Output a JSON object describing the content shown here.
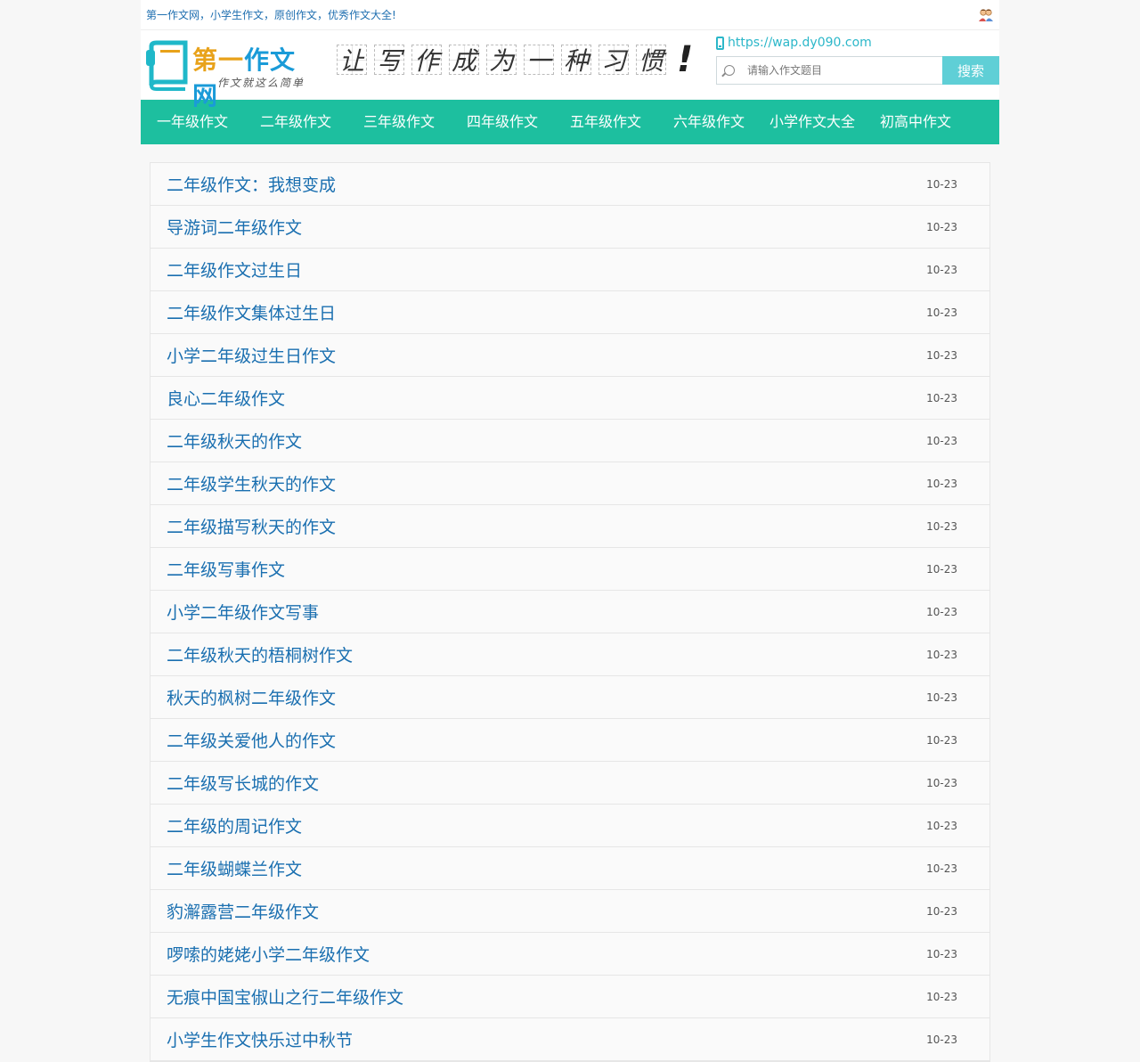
{
  "topbar": {
    "slogan": "第一作文网，小学生作文，原创作文，优秀作文大全!"
  },
  "header": {
    "logo_main": "第一作文网",
    "logo_first": "第一",
    "logo_rest": "作文网",
    "logo_tagline": "作文就这么简单",
    "motto_chars": [
      "让",
      "写",
      "作",
      "成",
      "为",
      "一",
      "种",
      "习",
      "惯"
    ],
    "motto_end": "!",
    "mobile_url": "https://wap.dy090.com",
    "search": {
      "placeholder": "请输入作文题目",
      "button": "搜索"
    }
  },
  "nav": {
    "items": [
      "一年级作文",
      "二年级作文",
      "三年级作文",
      "四年级作文",
      "五年级作文",
      "六年级作文",
      "小学作文大全",
      "初高中作文"
    ]
  },
  "articles": [
    {
      "title": "二年级作文：我想变成",
      "date": "10-23"
    },
    {
      "title": "导游词二年级作文",
      "date": "10-23"
    },
    {
      "title": "二年级作文过生日",
      "date": "10-23"
    },
    {
      "title": "二年级作文集体过生日",
      "date": "10-23"
    },
    {
      "title": "小学二年级过生日作文",
      "date": "10-23"
    },
    {
      "title": "良心二年级作文",
      "date": "10-23"
    },
    {
      "title": "二年级秋天的作文",
      "date": "10-23"
    },
    {
      "title": "二年级学生秋天的作文",
      "date": "10-23"
    },
    {
      "title": "二年级描写秋天的作文",
      "date": "10-23"
    },
    {
      "title": "二年级写事作文",
      "date": "10-23"
    },
    {
      "title": "小学二年级作文写事",
      "date": "10-23"
    },
    {
      "title": "二年级秋天的梧桐树作文",
      "date": "10-23"
    },
    {
      "title": "秋天的枫树二年级作文",
      "date": "10-23"
    },
    {
      "title": "二年级关爱他人的作文",
      "date": "10-23"
    },
    {
      "title": "二年级写长城的作文",
      "date": "10-23"
    },
    {
      "title": "二年级的周记作文",
      "date": "10-23"
    },
    {
      "title": "二年级蝴蝶兰作文",
      "date": "10-23"
    },
    {
      "title": "豹澥露营二年级作文",
      "date": "10-23"
    },
    {
      "title": "啰嗦的姥姥小学二年级作文",
      "date": "10-23"
    },
    {
      "title": "无痕中国宝俶山之行二年级作文",
      "date": "10-23"
    },
    {
      "title": "小学生作文快乐过中秋节",
      "date": "10-23"
    }
  ]
}
